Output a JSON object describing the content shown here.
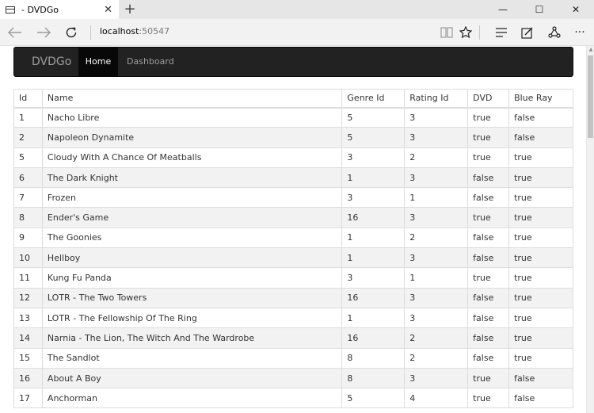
{
  "browser": {
    "tab_title": "- DVDGo",
    "tab_close": "✕",
    "new_tab": "+",
    "address_host": "localhost",
    "address_port": ":50547",
    "win_minimize": "—",
    "win_maximize": "☐",
    "win_close": "✕",
    "more": "···"
  },
  "navbar": {
    "brand": "DVDGo",
    "items": [
      {
        "label": "Home",
        "active": true
      },
      {
        "label": "Dashboard",
        "active": false
      }
    ]
  },
  "table": {
    "headers": [
      "Id",
      "Name",
      "Genre Id",
      "Rating Id",
      "DVD",
      "Blue Ray"
    ],
    "rows": [
      [
        "1",
        "Nacho Libre",
        "5",
        "3",
        "true",
        "false"
      ],
      [
        "2",
        "Napoleon Dynamite",
        "5",
        "3",
        "true",
        "false"
      ],
      [
        "5",
        "Cloudy With A Chance Of Meatballs",
        "3",
        "2",
        "true",
        "true"
      ],
      [
        "6",
        "The Dark Knight",
        "1",
        "3",
        "false",
        "true"
      ],
      [
        "7",
        "Frozen",
        "3",
        "1",
        "false",
        "true"
      ],
      [
        "8",
        "Ender's Game",
        "16",
        "3",
        "true",
        "true"
      ],
      [
        "9",
        "The Goonies",
        "1",
        "2",
        "false",
        "true"
      ],
      [
        "10",
        "Hellboy",
        "1",
        "3",
        "false",
        "true"
      ],
      [
        "11",
        "Kung Fu Panda",
        "3",
        "1",
        "true",
        "true"
      ],
      [
        "12",
        "LOTR - The Two Towers",
        "16",
        "3",
        "false",
        "true"
      ],
      [
        "13",
        "LOTR - The Fellowship Of The Ring",
        "1",
        "3",
        "false",
        "true"
      ],
      [
        "14",
        "Narnia - The Lion, The Witch And The Wardrobe",
        "16",
        "2",
        "false",
        "true"
      ],
      [
        "15",
        "The Sandlot",
        "8",
        "2",
        "false",
        "true"
      ],
      [
        "16",
        "About A Boy",
        "8",
        "3",
        "true",
        "false"
      ],
      [
        "17",
        "Anchorman",
        "5",
        "4",
        "true",
        "false"
      ]
    ]
  }
}
